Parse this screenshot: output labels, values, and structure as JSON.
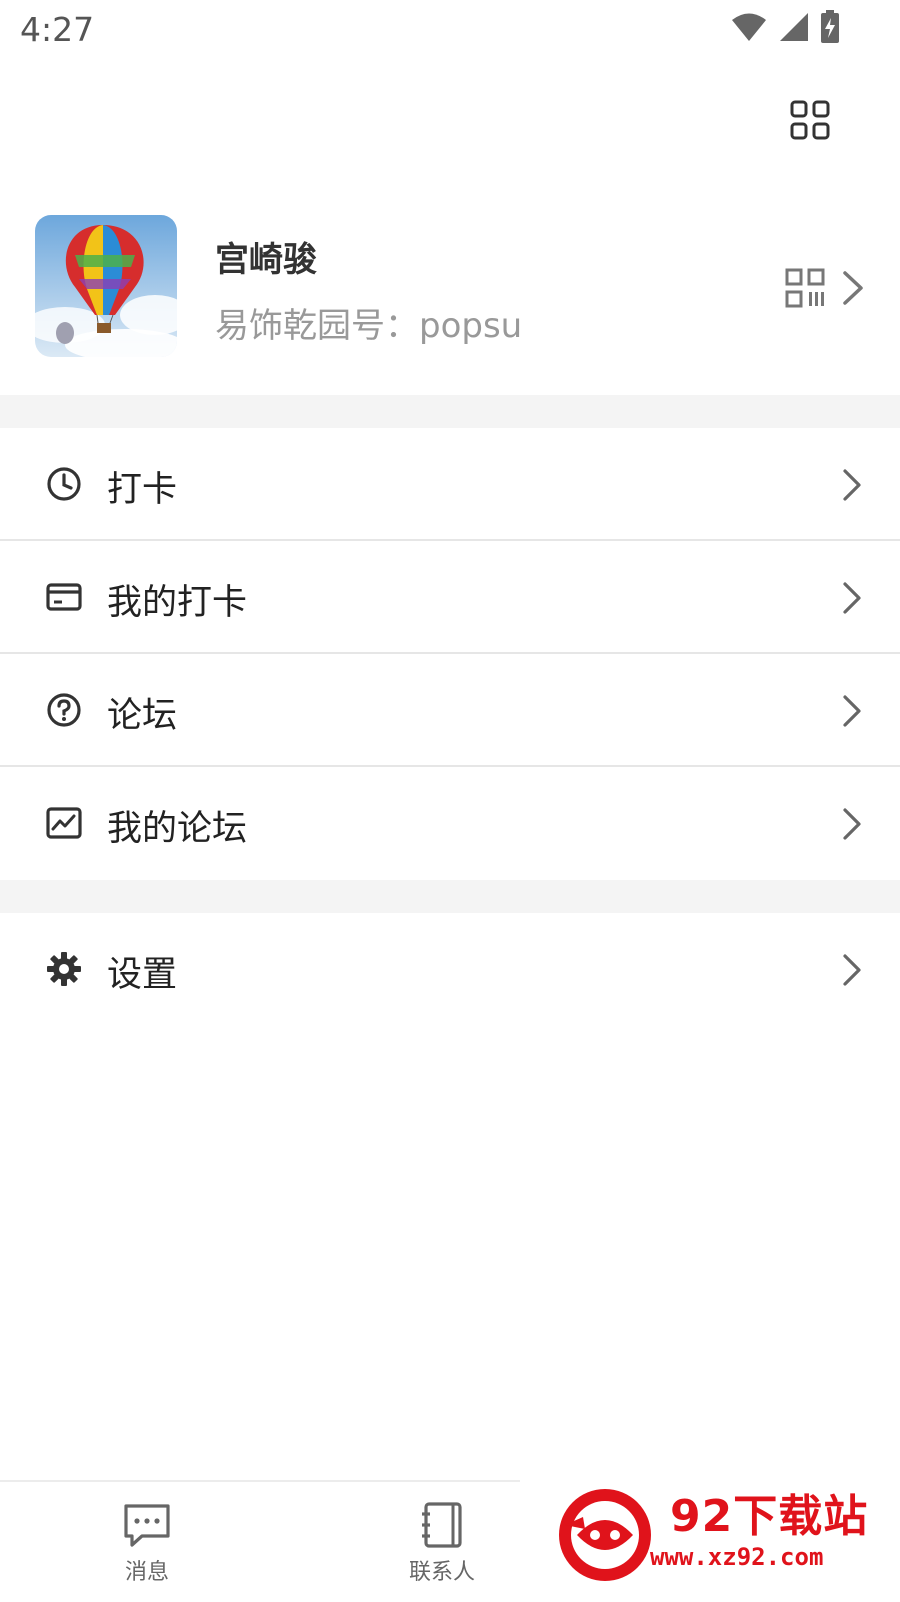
{
  "status_bar": {
    "time": "4:27"
  },
  "profile": {
    "name": "宫崎骏",
    "id_line": "易饰乾园号：popsu",
    "avatar_icon": "hot-air-balloon-image"
  },
  "menu": {
    "items": [
      {
        "label": "打卡",
        "icon": "clock-icon"
      },
      {
        "label": "我的打卡",
        "icon": "card-icon"
      },
      {
        "label": "论坛",
        "icon": "question-icon"
      },
      {
        "label": "我的论坛",
        "icon": "chart-image-icon"
      },
      {
        "label": "设置",
        "icon": "gear-icon"
      }
    ]
  },
  "bottom_nav": {
    "items": [
      {
        "label": "消息",
        "icon": "chat-bubble-icon"
      },
      {
        "label": "联系人",
        "icon": "contacts-book-icon"
      }
    ]
  },
  "watermark": {
    "title": "92下载站",
    "url": "www.xz92.com",
    "color": "#e0131b"
  },
  "colors": {
    "divider": "#e6e6e6",
    "section_gap": "#f4f4f4",
    "secondary_text": "#999999"
  }
}
